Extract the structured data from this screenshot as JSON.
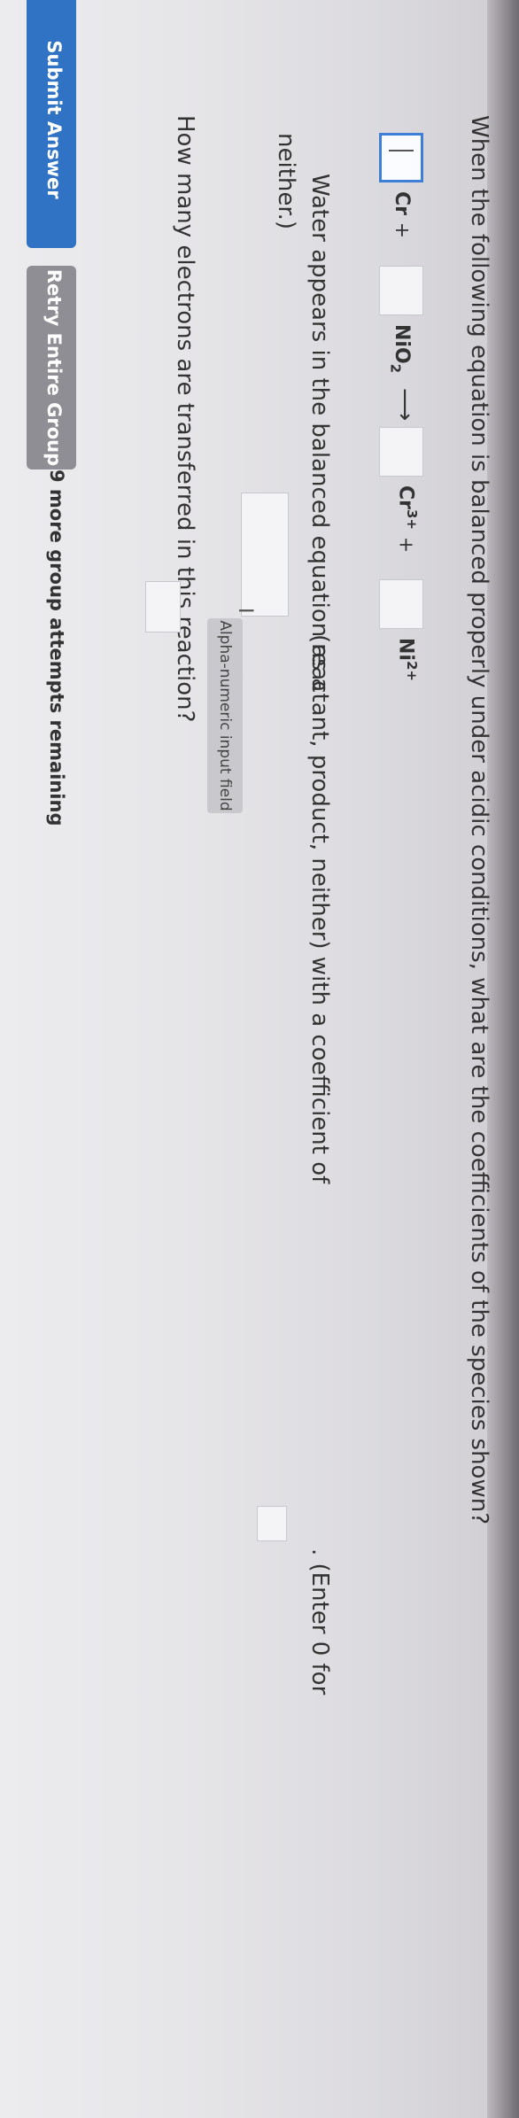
{
  "question": {
    "prompt": "When the following equation is balanced properly under acidic conditions, what are the coefficients of the species shown?",
    "equation": {
      "species": [
        {
          "formula": "Cr",
          "charge": "",
          "sub": "",
          "suffix": "+"
        },
        {
          "formula": "NiO",
          "sub": "2",
          "charge": "",
          "suffix": ""
        },
        {
          "formula": "Cr",
          "charge": "3+",
          "sub": "",
          "suffix": "+"
        },
        {
          "formula": "Ni",
          "charge": "2+",
          "sub": "",
          "suffix": ""
        }
      ],
      "arrow": "⟶",
      "active_value": "I"
    },
    "water_line1_prefix": "Water appears in the balanced equation as a",
    "water_line1_suffix": "(reactant, product, neither) with a coefficient of",
    "water_line1_end": ". (Enter 0 for",
    "water_line2": "neither.)",
    "tooltip": "Alpha-numeric input field",
    "electrons": "How many electrons are transferred in this reaction?"
  },
  "buttons": {
    "submit": "Submit Answer",
    "retry": "Retry Entire Group"
  },
  "attempts": "9 more group attempts remaining"
}
